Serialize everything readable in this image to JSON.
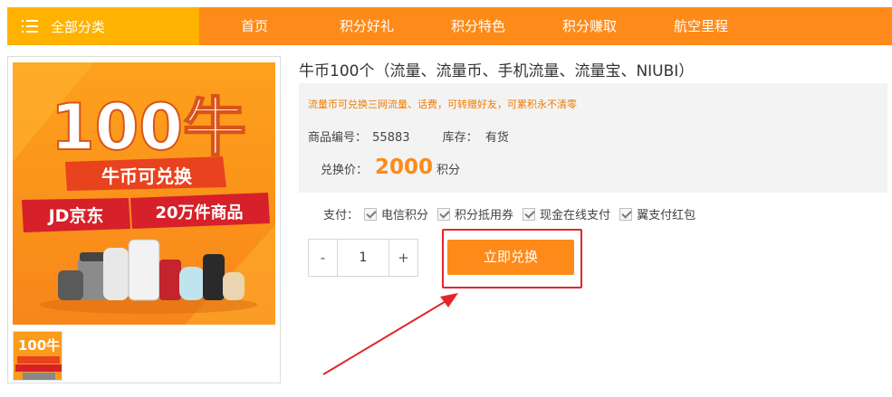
{
  "nav": {
    "all_categories": "全部分类",
    "items": [
      "首页",
      "积分好礼",
      "积分特色",
      "积分赚取",
      "航空里程"
    ]
  },
  "product": {
    "title": "牛币100个（流量、流量币、手机流量、流量宝、NIUBI）",
    "promo": "流量币可兑换三网流量、话费，可转赠好友，可累积永不清零",
    "sku_label": "商品编号：",
    "sku": "55883",
    "stock_label": "库存：",
    "stock": "有货",
    "price_label": "兑换价：",
    "price": "2000",
    "price_unit": "积分"
  },
  "banner": {
    "headline": "100牛",
    "line1": "牛币可兑换",
    "line2a": "JD京东",
    "line2b": "20万件商品"
  },
  "payment": {
    "label": "支付：",
    "options": [
      "电信积分",
      "积分抵用券",
      "现金在线支付",
      "翼支付红包"
    ]
  },
  "quantity": {
    "minus": "-",
    "value": "1",
    "plus": "+"
  },
  "action": {
    "redeem": "立即兑换"
  },
  "colors": {
    "accent": "#fe8a19",
    "nav_highlight": "#ffb200",
    "annotation": "#e4262a"
  }
}
